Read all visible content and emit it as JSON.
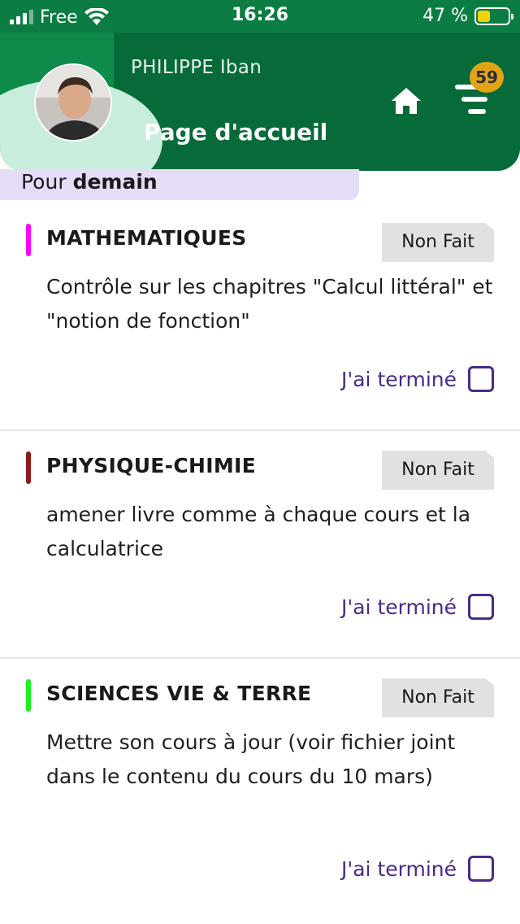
{
  "status_bar": {
    "carrier": "Free",
    "time": "16:26",
    "battery": "47 %",
    "battery_level": 0.47,
    "battery_color": "#f2d20f",
    "signal_icon": "signal-bars-icon",
    "wifi_icon": "wifi-icon"
  },
  "header": {
    "user_name": "PHILIPPE Iban",
    "page_title": "Page d'accueil",
    "home_icon": "home-icon",
    "menu_icon": "menu-icon",
    "notification_count": "59"
  },
  "colors": {
    "header_green": "#0e8a4a",
    "header_dark_green": "#066b39",
    "label_bg": "#e6dcf8",
    "accent_purple": "#4a2a8a",
    "badge": "#e2a417"
  },
  "section": {
    "prefix": "Pour",
    "day": "demain"
  },
  "homework": [
    {
      "subject": "MATHEMATIQUES",
      "color": "#ff00ff",
      "status": "Non Fait",
      "description": "Contrôle sur les chapitres \"Calcul littéral\" et \"notion de fonction\"",
      "done_label": "J'ai terminé",
      "done": false
    },
    {
      "subject": "PHYSIQUE-CHIMIE",
      "color": "#8b1a1a",
      "status": "Non Fait",
      "description": "amener livre comme à chaque cours et la calculatrice",
      "done_label": "J'ai terminé",
      "done": false
    },
    {
      "subject": "SCIENCES VIE & TERRE",
      "color": "#19f21f",
      "status": "Non Fait",
      "description": "Mettre son cours à jour (voir fichier joint dans le contenu du cours du 10 mars)",
      "done_label": "J'ai terminé",
      "done": false
    }
  ]
}
